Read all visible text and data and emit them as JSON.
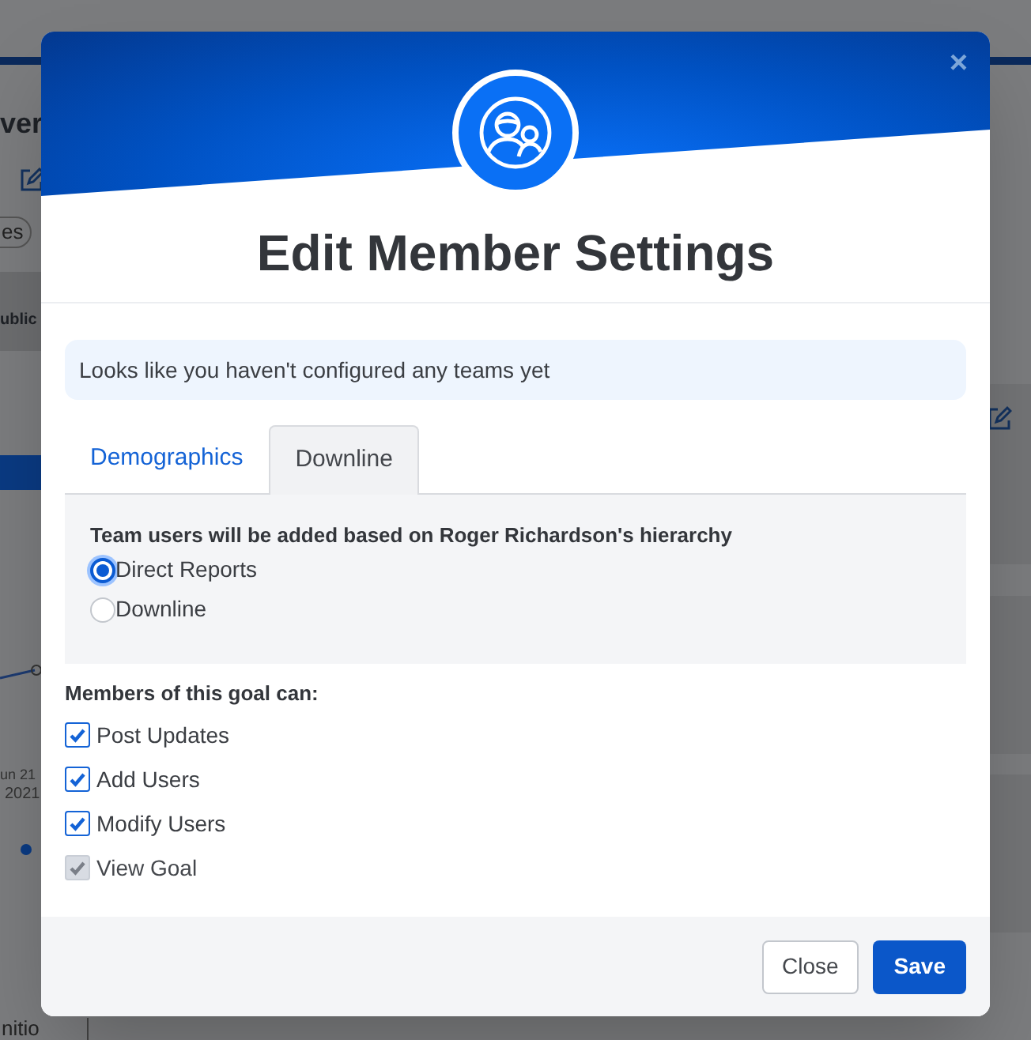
{
  "background": {
    "title_fragment": "ver",
    "chip_fragment": "es",
    "heading_fragment": "ublic",
    "axis_label": "un 21",
    "axis_year": "2021",
    "button_fragment": "nitio"
  },
  "dialog": {
    "title": "Edit Member Settings",
    "close": "×",
    "notice": "Looks like you haven't configured any teams yet",
    "tabs": [
      {
        "label": "Demographics",
        "selected": false
      },
      {
        "label": "Downline",
        "selected": true
      }
    ],
    "hierarchy_heading": "Team users will be added based on Roger Richardson's hierarchy",
    "radios": [
      {
        "label": "Direct Reports",
        "selected": true
      },
      {
        "label": "Downline",
        "selected": false
      }
    ],
    "permissions_heading": "Members of this goal can:",
    "permissions": [
      {
        "label": "Post Updates",
        "checked": true,
        "disabled": false
      },
      {
        "label": "Add Users",
        "checked": true,
        "disabled": false
      },
      {
        "label": "Modify Users",
        "checked": true,
        "disabled": false
      },
      {
        "label": "View Goal",
        "checked": true,
        "disabled": true
      }
    ],
    "buttons": [
      {
        "label": "Close",
        "kind": "secondary"
      },
      {
        "label": "Save",
        "kind": "primary"
      }
    ]
  }
}
